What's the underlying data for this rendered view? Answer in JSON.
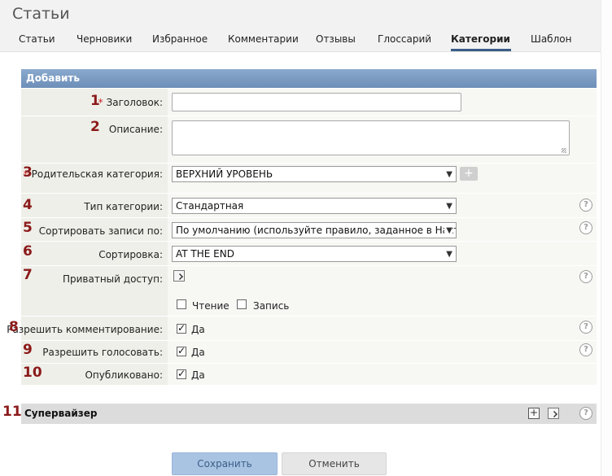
{
  "header": {
    "title": "Статьи"
  },
  "tabs": [
    {
      "label": "Статьи"
    },
    {
      "label": "Черновики"
    },
    {
      "label": "Избранное"
    },
    {
      "label": "Комментарии"
    },
    {
      "label": "Отзывы"
    },
    {
      "label": "Глоссарий"
    },
    {
      "label": "Категории",
      "active": true
    },
    {
      "label": "Шаблон"
    }
  ],
  "panel": {
    "title": "Добавить"
  },
  "form": {
    "title_field": {
      "num": "1",
      "label": "Заголовок:",
      "value": "",
      "required": true
    },
    "description_field": {
      "num": "2",
      "label": "Описание:",
      "value": ""
    },
    "parent_category": {
      "num": "3",
      "label": "Родительская категория:",
      "value": "ВЕРХНИЙ УРОВЕНЬ",
      "required": true,
      "add_label": "+"
    },
    "category_type": {
      "num": "4",
      "label": "Тип категории:",
      "value": "Стандартная"
    },
    "sort_entries": {
      "num": "5",
      "label": "Сортировать записи по:",
      "value": "По умолчанию (используйте правило, заданное в Настр"
    },
    "sorting": {
      "num": "6",
      "label": "Сортировка:",
      "value": "AT THE END"
    },
    "private_access": {
      "num": "7",
      "label": "Приватный доступ:",
      "read_label": "Чтение",
      "write_label": "Запись",
      "read_checked": false,
      "write_checked": false
    },
    "allow_comments": {
      "num": "8",
      "label": "Разрешить комментирование:",
      "option_label": "Да",
      "checked": true
    },
    "allow_voting": {
      "num": "9",
      "label": "Разрешить голосовать:",
      "option_label": "Да",
      "checked": true
    },
    "published": {
      "num": "10",
      "label": "Опубликовано:",
      "option_label": "Да",
      "checked": true
    }
  },
  "supervisor": {
    "num": "11",
    "title": "Супервайзер"
  },
  "buttons": {
    "save": "Сохранить",
    "cancel": "Отменить"
  },
  "help_glyph": "?",
  "required_mark": "*",
  "colors": {
    "panel_header": "#7b9cc4",
    "number": "#8b1a1a",
    "required": "#c81e1e"
  }
}
